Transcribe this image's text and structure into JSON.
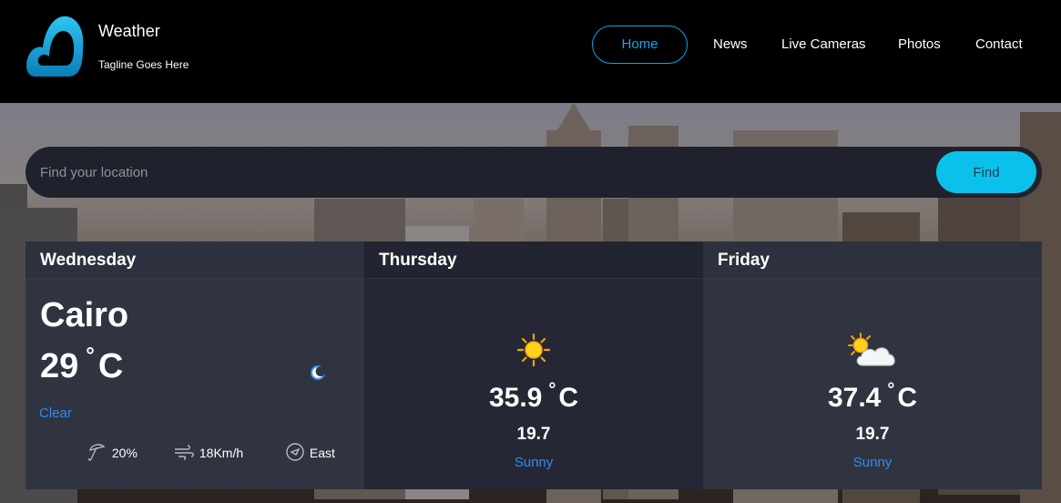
{
  "brand": {
    "title": "Weather",
    "tagline": "Tagline Goes Here",
    "logo_icon": "cloud-logo-icon"
  },
  "nav": {
    "items": [
      "Home",
      "News",
      "Live Cameras",
      "Photos",
      "Contact"
    ],
    "active": "Home"
  },
  "search": {
    "placeholder": "Find your location",
    "value": "",
    "button_label": "Find"
  },
  "colors": {
    "accent": "#0bc1ec",
    "link": "#2f8cf4",
    "card_bg": "#303441",
    "card_alt_bg": "#252834"
  },
  "today": {
    "day": "Wednesday",
    "city": "Cairo",
    "temp": "29",
    "unit": "C",
    "degree_symbol": "°",
    "condition": "Clear",
    "condition_icon": "moon-icon",
    "humidity": "20%",
    "wind": "18Km/h",
    "direction": "East"
  },
  "forecast": [
    {
      "day": "Thursday",
      "high": "35.9",
      "unit": "C",
      "degree_symbol": "°",
      "low": "19.7",
      "condition": "Sunny",
      "icon": "sun-icon"
    },
    {
      "day": "Friday",
      "high": "37.4",
      "unit": "C",
      "degree_symbol": "°",
      "low": "19.7",
      "condition": "Sunny",
      "icon": "partly-cloudy-icon"
    }
  ]
}
